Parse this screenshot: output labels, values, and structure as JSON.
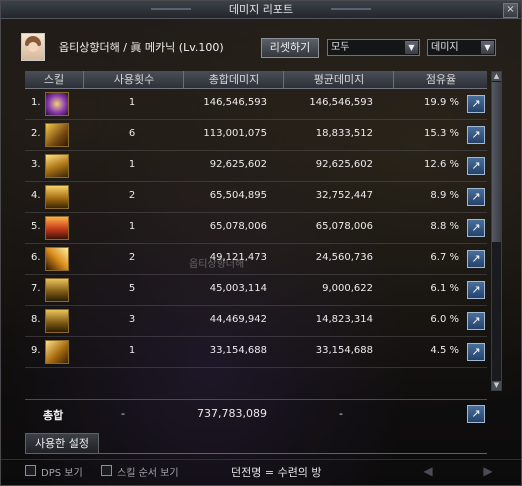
{
  "window": {
    "title": "데미지 리포트"
  },
  "header": {
    "character": "옵티상향더해 / 眞 메카닉 (Lv.100)",
    "reset_label": "리셋하기",
    "filter_select": "모두",
    "type_select": "데미지"
  },
  "table": {
    "columns": [
      "스킬",
      "사용횟수",
      "총합데미지",
      "평균데미지",
      "점유율"
    ],
    "rows": [
      {
        "rank": "1.",
        "icon": "hexagon-burst-icon",
        "count": "1",
        "total": "146,546,593",
        "average": "146,546,593",
        "share": "19.9 %"
      },
      {
        "rank": "2.",
        "icon": "crossed-cannons-icon",
        "count": "6",
        "total": "113,001,075",
        "average": "18,833,512",
        "share": "15.3 %"
      },
      {
        "rank": "3.",
        "icon": "missile-icon",
        "count": "1",
        "total": "92,625,602",
        "average": "92,625,602",
        "share": "12.6 %"
      },
      {
        "rank": "4.",
        "icon": "mech-stack-icon",
        "count": "2",
        "total": "65,504,895",
        "average": "32,752,447",
        "share": "8.9 %"
      },
      {
        "rank": "5.",
        "icon": "flame-mech-icon",
        "count": "1",
        "total": "65,078,006",
        "average": "65,078,006",
        "share": "8.8 %"
      },
      {
        "rank": "6.",
        "icon": "laser-beam-icon",
        "count": "2",
        "total": "49,121,473",
        "average": "24,560,736",
        "share": "6.7 %"
      },
      {
        "rank": "7.",
        "icon": "g2-drone-icon",
        "count": "5",
        "total": "45,003,114",
        "average": "9,000,622",
        "share": "6.1 %"
      },
      {
        "rank": "8.",
        "icon": "g3-drone-icon",
        "count": "3",
        "total": "44,469,942",
        "average": "14,823,314",
        "share": "6.0 %"
      },
      {
        "rank": "9.",
        "icon": "rocket-barrage-icon",
        "count": "1",
        "total": "33,154,688",
        "average": "33,154,688",
        "share": "4.5 %"
      }
    ]
  },
  "total": {
    "label": "총합",
    "count": "-",
    "total": "737,783,089",
    "average": "-"
  },
  "tabs": {
    "used_settings": "사용한 설정"
  },
  "footer": {
    "dps_label": "DPS 보기",
    "skill_order_label": "스킬 순서 보기",
    "dungeon": "던전명 = 수련의 방"
  },
  "watermark": "옵티상향더해",
  "colors": {
    "accent_share": "#3a6ea8",
    "gold": "#c89a2a"
  }
}
